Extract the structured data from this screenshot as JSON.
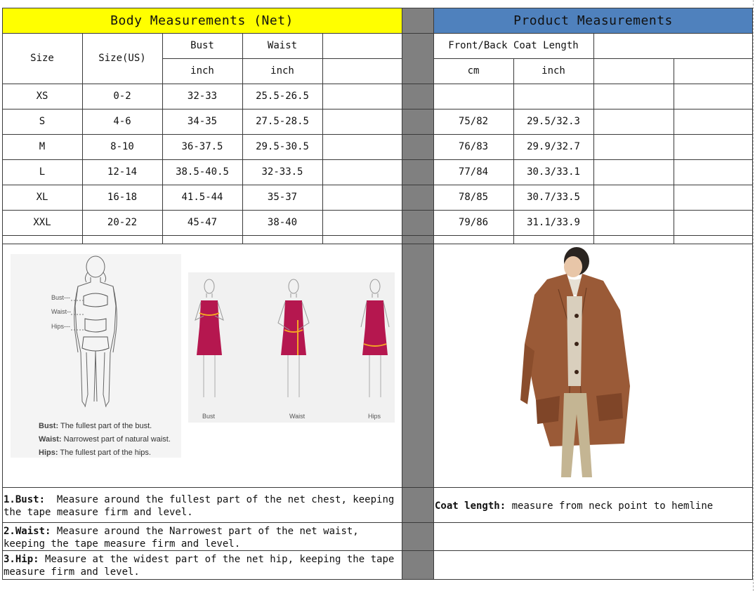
{
  "left_header": "Body Measurements (Net)",
  "right_header": "Product Measurements",
  "columns": {
    "size": "Size",
    "size_us": "Size(US)",
    "bust": "Bust",
    "waist": "Waist",
    "bust_unit": "inch",
    "waist_unit": "inch",
    "front_back": "Front/Back Coat Length",
    "cm": "cm",
    "inch": "inch"
  },
  "rows": [
    {
      "size": "XS",
      "us": "0-2",
      "bust": "32-33",
      "waist": "25.5-26.5",
      "cm": "",
      "inch": ""
    },
    {
      "size": "S",
      "us": "4-6",
      "bust": "34-35",
      "waist": "27.5-28.5",
      "cm": "75/82",
      "inch": "29.5/32.3"
    },
    {
      "size": "M",
      "us": "8-10",
      "bust": "36-37.5",
      "waist": "29.5-30.5",
      "cm": "76/83",
      "inch": "29.9/32.7"
    },
    {
      "size": "L",
      "us": "12-14",
      "bust": "38.5-40.5",
      "waist": "32-33.5",
      "cm": "77/84",
      "inch": "30.3/33.1"
    },
    {
      "size": "XL",
      "us": "16-18",
      "bust": "41.5-44",
      "waist": "35-37",
      "cm": "78/85",
      "inch": "30.7/33.5"
    },
    {
      "size": "XXL",
      "us": "20-22",
      "bust": "45-47",
      "waist": "38-40",
      "cm": "79/86",
      "inch": "31.1/33.9"
    }
  ],
  "figure": {
    "bust_tag": "Bust---",
    "waist_tag": "Waist--",
    "hips_tag": "Hips---",
    "legend_bust_term": "Bust:",
    "legend_bust_text": "The fullest part of the bust.",
    "legend_waist_term": "Waist:",
    "legend_waist_text": "Narrowest part of natural waist.",
    "legend_hips_term": "Hips:",
    "legend_hips_text": "The fullest part of the hips.",
    "cap_bust": "Bust",
    "cap_waist": "Waist",
    "cap_hips": "Hips"
  },
  "notes": {
    "bust_term": "1.Bust:",
    "bust_text": "Measure around the fullest part of the net chest, keeping the tape  measure firm and level.",
    "waist_term": "2.Waist:",
    "waist_text": "Measure around the Narrowest part of the net waist, keeping the tape  measure firm and level.",
    "hip_term": "3.Hip:",
    "hip_text": "Measure at the widest part of the net hip, keeping the tape measure firm and level.",
    "coat_term": "Coat length:",
    "coat_text": "measure from neck point to hemline"
  },
  "colors": {
    "left_header_bg": "#ffff00",
    "right_header_bg": "#4f81bd",
    "divider_col": "#808080",
    "dress": "#b5174f",
    "coat": "#9a5a37"
  }
}
